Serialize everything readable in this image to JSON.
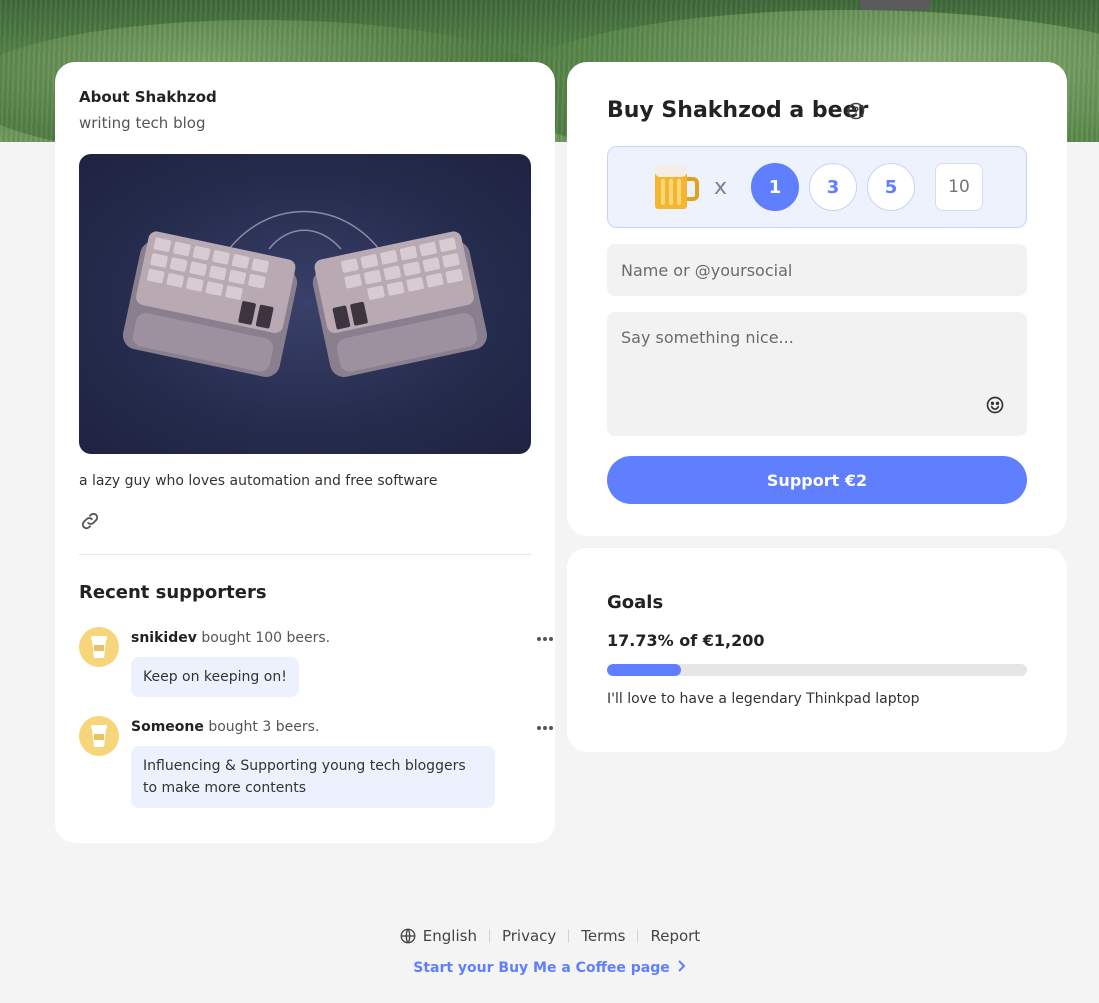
{
  "about": {
    "title": "About Shakhzod",
    "subtitle": "writing tech blog",
    "bio": "a lazy guy who loves automation and free software",
    "link_icon": "link-icon"
  },
  "recent_supporters": {
    "title": "Recent supporters",
    "items": [
      {
        "name": "snikidev",
        "action": "bought 100 beers.",
        "message": "Keep on keeping on!"
      },
      {
        "name": "Someone",
        "action": "bought 3 beers.",
        "message": "Influencing & Supporting young tech bloggers to make more contents"
      }
    ]
  },
  "buy": {
    "title": "Buy Shakhzod a beer",
    "times": "x",
    "quantities": [
      "1",
      "3",
      "5"
    ],
    "selected_quantity": "1",
    "custom_quantity_placeholder": "10",
    "name_placeholder": "Name or @yoursocial",
    "message_placeholder": "Say something nice...",
    "support_label": "Support €2"
  },
  "goals": {
    "title": "Goals",
    "progress_text": "17.73% of €1,200",
    "progress_percent": 17.73,
    "description": "I'll love to have a legendary Thinkpad laptop"
  },
  "footer": {
    "language": "English",
    "links": [
      "Privacy",
      "Terms",
      "Report"
    ],
    "cta": "Start your Buy Me a Coffee page"
  },
  "colors": {
    "accent": "#5f7fff",
    "bubble": "#edf1fd",
    "page_bg": "#f4f4f4"
  }
}
